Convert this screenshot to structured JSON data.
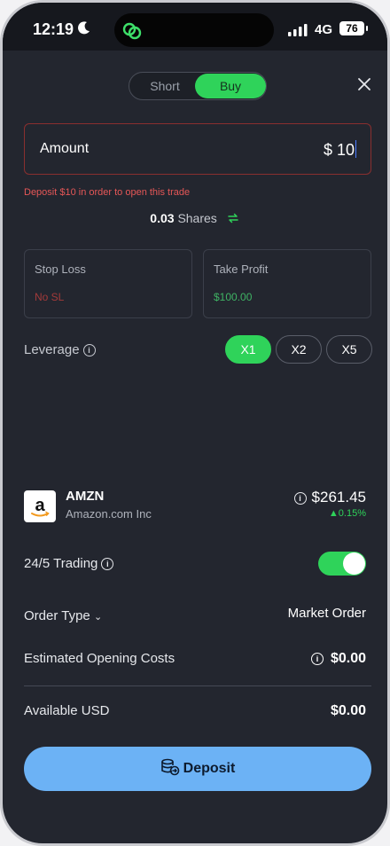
{
  "status_bar": {
    "time": "12:19",
    "network": "4G",
    "battery": "76"
  },
  "toggle_tabs": {
    "short_label": "Short",
    "buy_label": "Buy",
    "active": "Buy"
  },
  "amount": {
    "label": "Amount",
    "currency": "$",
    "value": "10"
  },
  "error_message": "Deposit $10 in order to open this trade",
  "shares": {
    "value": "0.03",
    "label": "Shares"
  },
  "stop_loss": {
    "title": "Stop Loss",
    "value": "No SL",
    "color": "#a33a3a"
  },
  "take_profit": {
    "title": "Take Profit",
    "value": "$100.00",
    "color": "#3fb364"
  },
  "leverage": {
    "label": "Leverage",
    "options": [
      "X1",
      "X2",
      "X5"
    ],
    "selected": "X1"
  },
  "asset": {
    "ticker": "AMZN",
    "name": "Amazon.com Inc",
    "price": "$261.45",
    "change": "0.15%"
  },
  "trading_24_5": {
    "label": "24/5 Trading",
    "enabled": true
  },
  "order_type": {
    "label": "Order Type",
    "value": "Market Order"
  },
  "opening_costs": {
    "label": "Estimated Opening Costs",
    "value": "$0.00"
  },
  "available": {
    "label": "Available USD",
    "value": "$0.00"
  },
  "deposit_button": {
    "label": "Deposit"
  },
  "colors": {
    "accent_green": "#2fd35a",
    "deposit_blue": "#6cb2f5",
    "error_red": "#e65757",
    "background": "#23262f"
  }
}
